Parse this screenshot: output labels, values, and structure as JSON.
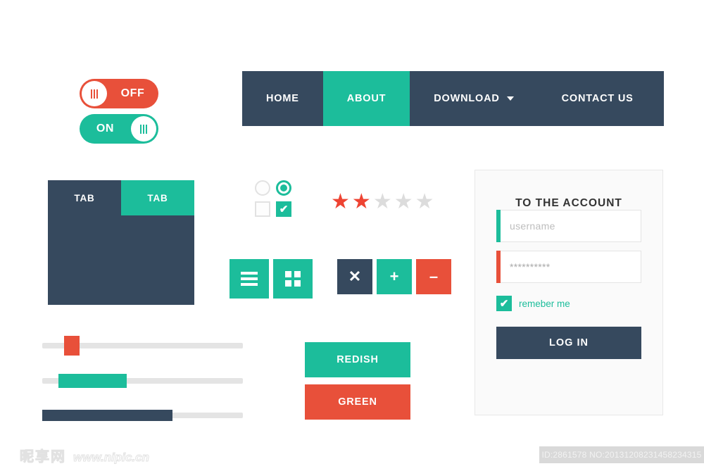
{
  "toggles": [
    {
      "name": "off",
      "label": "OFF",
      "state": "off",
      "color": "#e8503a"
    },
    {
      "name": "on",
      "label": "ON",
      "state": "on",
      "color": "#1cbd9b"
    }
  ],
  "navbar": {
    "items": [
      {
        "label": "HOME",
        "active": false,
        "has_caret": false
      },
      {
        "label": "ABOUT",
        "active": true,
        "has_caret": false
      },
      {
        "label": "DOWNLOAD",
        "active": false,
        "has_caret": true
      },
      {
        "label": "CONTACT US",
        "active": false,
        "has_caret": false
      }
    ]
  },
  "tabs": {
    "items": [
      {
        "label": "TAB",
        "active": false
      },
      {
        "label": "TAB",
        "active": true
      }
    ]
  },
  "choices": {
    "radio_unchecked": "radio-unchecked",
    "radio_checked": "radio-checked",
    "checkbox_unchecked": "checkbox-unchecked",
    "checkbox_checked": "checkbox-checked",
    "check_glyph": "✔"
  },
  "rating": {
    "filled": 2,
    "total": 5,
    "glyph": "★",
    "filled_color": "#ee4433",
    "empty_color": "#dcdcdc"
  },
  "icon_buttons": {
    "group_a": [
      {
        "icon": "list-icon",
        "color": "teal"
      },
      {
        "icon": "grid-icon",
        "color": "teal"
      }
    ],
    "group_b": [
      {
        "icon": "close-icon",
        "glyph": "✕",
        "color": "navy"
      },
      {
        "icon": "plus-icon",
        "glyph": "✛",
        "color": "teal"
      },
      {
        "icon": "minus-icon",
        "glyph": "—",
        "color": "red"
      }
    ]
  },
  "sliders": [
    {
      "name": "slider-handle-red",
      "type": "handle",
      "value_pct": 11,
      "color": "#e8503a"
    },
    {
      "name": "slider-range-teal",
      "type": "range",
      "start_pct": 8,
      "end_pct": 42,
      "color": "#1cbd9b"
    },
    {
      "name": "progress-navy",
      "type": "progress",
      "value_pct": 65,
      "color": "#36495e"
    }
  ],
  "color_buttons": [
    {
      "label": "REDISH",
      "style": "teal"
    },
    {
      "label": "GREEN",
      "style": "red"
    }
  ],
  "login": {
    "title": "TO THE ACCOUNT",
    "username": {
      "placeholder": "username",
      "value": ""
    },
    "password": {
      "placeholder": "",
      "value": "**********"
    },
    "remember": {
      "label": "remeber me",
      "checked": true,
      "glyph": "✔"
    },
    "submit_label": "LOG IN"
  },
  "footer": {
    "watermark_cn": "昵享网",
    "watermark_url": "www.nipic.cn",
    "id_text": "ID:2861578 NO:20131208231458234315"
  },
  "palette": {
    "teal": "#1cbd9b",
    "navy": "#36495e",
    "red": "#e8503a",
    "track": "#e4e4e4",
    "panel_bg": "#fafafa"
  }
}
